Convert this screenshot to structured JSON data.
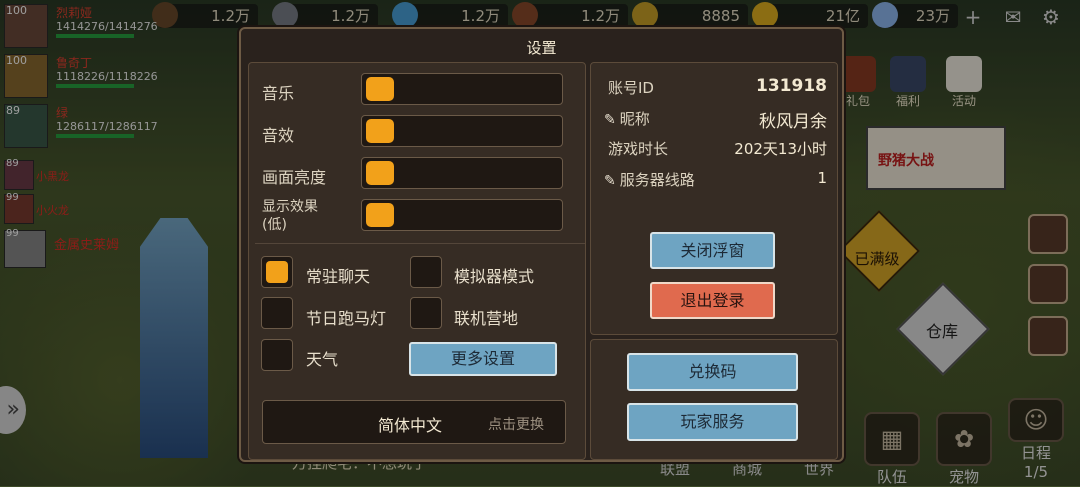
{
  "topbar": {
    "resources": [
      {
        "value": "1.2万",
        "icon": "wood-icon",
        "color": "#6a4a2a"
      },
      {
        "value": "1.2万",
        "icon": "stone-icon",
        "color": "#7a7f88"
      },
      {
        "value": "1.2万",
        "icon": "crystal-icon",
        "color": "#4aa0d8"
      },
      {
        "value": "1.2万",
        "icon": "log-icon",
        "color": "#8a4a2a"
      },
      {
        "value": "8885",
        "icon": "wheat-icon",
        "color": "#c8a028"
      },
      {
        "value": "21亿",
        "icon": "coin-icon",
        "color": "#e0b020"
      },
      {
        "value": "23万",
        "icon": "diamond-icon",
        "color": "#8fb8f0"
      }
    ]
  },
  "team": [
    {
      "level": "100",
      "name": "烈莉娅",
      "hp": "1414276/1414276"
    },
    {
      "level": "100",
      "name": "鲁奇丁",
      "hp": "1118226/1118226"
    },
    {
      "level": "89",
      "name": "绿",
      "hp": "1286117/1286117"
    }
  ],
  "minis": [
    {
      "level": "89",
      "name": "小黑龙"
    },
    {
      "level": "99",
      "name": "小火龙"
    },
    {
      "level": "99",
      "name": "金属史莱姆"
    }
  ],
  "widgets": {
    "gift": "礼包",
    "welfare": "福利",
    "activity": "活动",
    "banner_text": "野猪大战"
  },
  "side_buttons": {
    "max_level": "已满级",
    "warehouse": "仓库"
  },
  "bottom": {
    "alliance": "联盟",
    "shop": "商城",
    "world": "世界",
    "team": "队伍",
    "pet": "宠物",
    "schedule": "日程",
    "schedule_count": "1/5"
  },
  "chat_line": "万挂爬宅：不想玩了",
  "dialog": {
    "title": "设置",
    "sliders": [
      {
        "label": "音乐"
      },
      {
        "label": "音效"
      },
      {
        "label": "画面亮度"
      },
      {
        "label": "显示效果\n(低)"
      }
    ],
    "toggles": [
      {
        "label": "常驻聊天",
        "checked": true
      },
      {
        "label": "模拟器模式",
        "checked": false
      },
      {
        "label": "节日跑马灯",
        "checked": false
      },
      {
        "label": "联机营地",
        "checked": false
      },
      {
        "label": "天气",
        "checked": false
      }
    ],
    "more_settings": "更多设置",
    "language": "简体中文",
    "language_hint": "点击更换",
    "account": {
      "id_label": "账号ID",
      "id_value": "131918",
      "nick_label": "昵称",
      "nick_value": "秋风月余",
      "playtime_label": "游戏时长",
      "playtime_value": "202天13小时",
      "server_label": "服务器线路",
      "server_value": "1"
    },
    "close_float": "关闭浮窗",
    "logout": "退出登录",
    "redeem": "兑换码",
    "player_service": "玩家服务"
  }
}
